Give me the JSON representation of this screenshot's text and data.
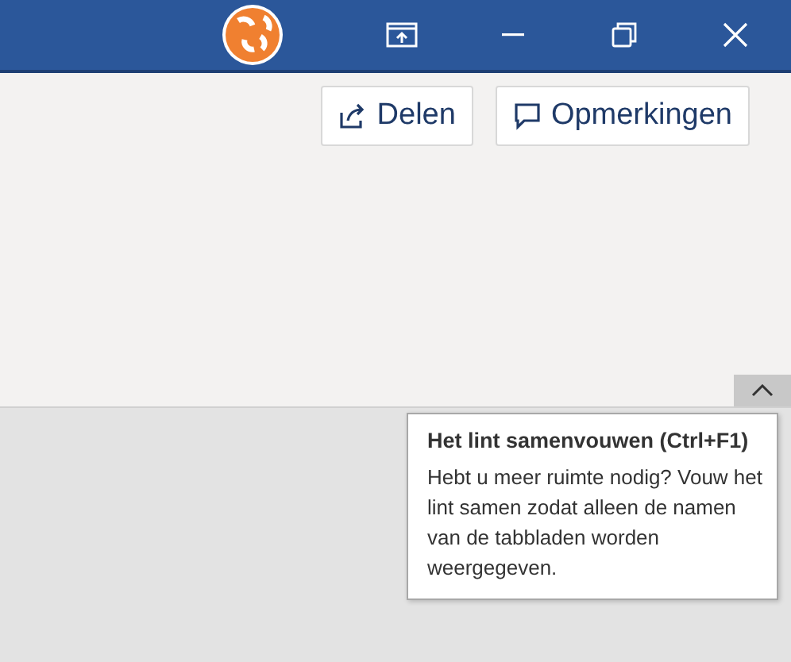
{
  "ribbon_actions": [
    {
      "label": "Delen",
      "kind": "share"
    },
    {
      "label": "Opmerkingen",
      "kind": "comments"
    }
  ],
  "tooltip": {
    "title": "Het lint samenvouwen (Ctrl+F1)",
    "body": "Hebt u meer ruimte nodig? Vouw het lint samen zodat alleen de namen van de tabbladen worden weergegeven."
  }
}
